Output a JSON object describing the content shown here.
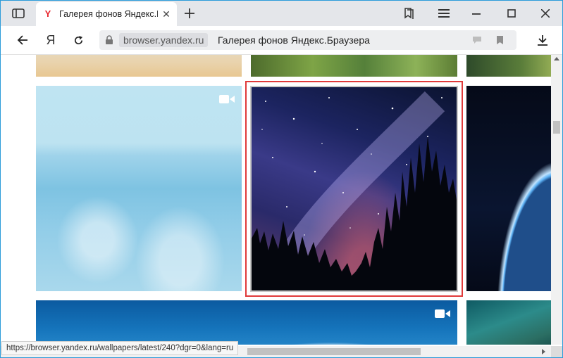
{
  "tab": {
    "favicon": "Y",
    "title": "Галерея фонов Яндекс.Браузера",
    "close_label": "✕"
  },
  "toolbar": {
    "ya_label": "Я"
  },
  "address": {
    "domain": "browser.yandex.ru",
    "page_title": "Галерея фонов Яндекс.Браузера"
  },
  "gallery": {
    "thumbnails": [
      {
        "name": "sand-thumb",
        "has_video": false
      },
      {
        "name": "grass-thumb",
        "has_video": false
      },
      {
        "name": "forest-thumb",
        "has_video": false
      },
      {
        "name": "sea-thumb",
        "has_video": true
      },
      {
        "name": "starry-night-thumb",
        "has_video": false,
        "selected": true
      },
      {
        "name": "earth-thumb",
        "has_video": false
      },
      {
        "name": "wave-thumb",
        "has_video": true
      },
      {
        "name": "coast-thumb",
        "has_video": false
      }
    ],
    "highlight_color": "#e03a3a"
  },
  "status": {
    "link_url": "https://browser.yandex.ru/wallpapers/latest/240?dgr=0&lang=ru"
  },
  "colors": {
    "window_border": "#2b9bd9",
    "tabbar_bg": "#e4e6ea",
    "omnibox_bg": "#edeef0"
  },
  "icons": [
    "sidebar-icon",
    "yandex-favicon-icon",
    "close-icon",
    "plus-icon",
    "bookmarks-icon",
    "menu-icon",
    "minimize-icon",
    "maximize-icon",
    "window-close-icon",
    "back-arrow-icon",
    "reload-icon",
    "lock-icon",
    "comment-icon",
    "bookmark-icon",
    "download-icon",
    "video-icon"
  ]
}
